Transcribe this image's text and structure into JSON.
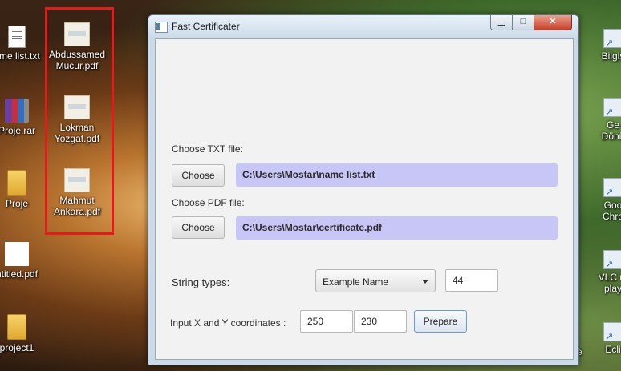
{
  "desktop": {
    "left_icons": [
      {
        "name": "name-list-txt",
        "label": "ame list.txt",
        "icon": "text-file-icon"
      },
      {
        "name": "proje-rar",
        "label": "Proje.rar",
        "icon": "rar-archive-icon"
      },
      {
        "name": "proje-folder",
        "label": "Proje",
        "icon": "folder-icon"
      },
      {
        "name": "untitled-pdf",
        "label": "ntitled.pdf",
        "icon": "pdf-file-icon"
      },
      {
        "name": "project1-folder",
        "label": "project1",
        "icon": "folder-icon"
      }
    ],
    "pdf_icons": [
      {
        "label": "Abdussamed\nMucur.pdf"
      },
      {
        "label": "Lokman\nYozgat.pdf"
      },
      {
        "label": "Mahmut\nAnkara.pdf"
      }
    ],
    "right_icons": [
      {
        "label": "Bilgis"
      },
      {
        "label": "Ge\nDönü"
      },
      {
        "label": "Goo\nChro"
      },
      {
        "label": "VLC m\nplay"
      },
      {
        "label": "Ecli"
      }
    ],
    "partial_text": "ne",
    "highlight_color": "#e21b1b"
  },
  "window": {
    "title": "Fast Certificater",
    "controls": {
      "minimize": "▁",
      "maximize": "□",
      "close": "✕"
    }
  },
  "form": {
    "txt_label": "Choose TXT file:",
    "txt_button": "Choose",
    "txt_path": "C:\\Users\\Mostar\\name list.txt",
    "pdf_label": "Choose PDF file:",
    "pdf_button": "Choose",
    "pdf_path": "C:\\Users\\Mostar\\certificate.pdf",
    "string_types_label": "String types:",
    "string_type_selected": "Example Name",
    "font_size": "44",
    "coords_label": "Input X and Y coordinates :",
    "x_value": "250",
    "y_value": "230",
    "prepare_button": "Prepare",
    "path_bg_color": "#c8c6f7"
  }
}
